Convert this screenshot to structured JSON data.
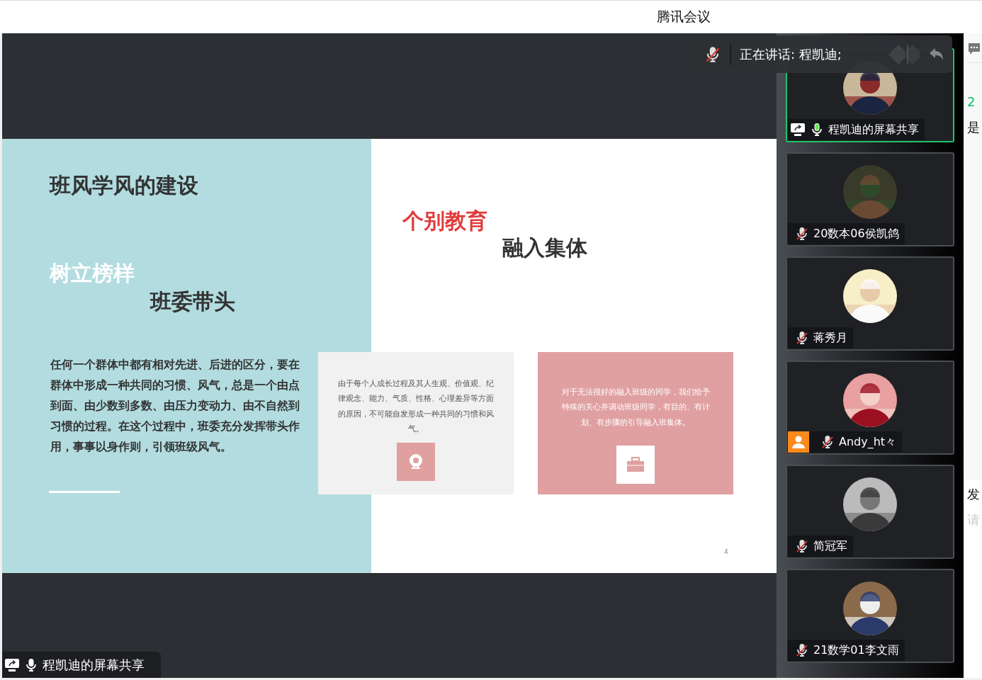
{
  "window": {
    "title": "腾讯会议"
  },
  "speaking_bar": {
    "muted": true,
    "text": "正在讲话: 程凯迪;"
  },
  "slide": {
    "title": "班风学风的建设",
    "heading_light": "树立榜样",
    "heading_dark": "班委带头",
    "paragraph": "任何一个群体中都有相对先进、后进的区分，要在群体中形成一种共同的习惯、风气，总是一个由点到面、由少数到多数、由压力变动力、由不自然到习惯的过程。在这个过程中，班委充分发挥带头作用，事事以身作则，引领班级风气。",
    "accent_heading": "个别教育",
    "sub_heading": "融入集体",
    "cards": [
      {
        "kind": "light",
        "text": "由于每个人成长过程及其人生观、价值观、纪律观念、能力、气质、性格、心理差异等方面的原因，不可能自发形成一种共同的习惯和风气。"
      },
      {
        "kind": "pink",
        "text": "对于无法很好的融入班级的同学，我们给予特殊的关心并调动班级同学，有目的、有计划、有步骤的引导融入班集体。"
      }
    ],
    "page_number": "4"
  },
  "share_label": {
    "muted": false,
    "text": "程凯迪的屏幕共享"
  },
  "participants": [
    {
      "name": "程凯迪的屏幕共享",
      "muted": false,
      "sharing": true,
      "host": false,
      "speaking": true
    },
    {
      "name": "20数本06侯凯鸽",
      "muted": true,
      "sharing": false,
      "host": false,
      "speaking": false
    },
    {
      "name": "蒋秀月",
      "muted": true,
      "sharing": false,
      "host": false,
      "speaking": false
    },
    {
      "name": "Andy_ht々",
      "muted": true,
      "sharing": false,
      "host": true,
      "speaking": false
    },
    {
      "name": "简冠军",
      "muted": true,
      "sharing": false,
      "host": false,
      "speaking": false
    },
    {
      "name": "21数学01李文雨",
      "muted": true,
      "sharing": false,
      "host": false,
      "speaking": false
    }
  ],
  "side_panel": {
    "top_texts": [
      {
        "kind": "count",
        "text": "2"
      },
      {
        "kind": "plain",
        "text": "是"
      }
    ],
    "bottom_texts": [
      {
        "kind": "plain",
        "text": "发"
      },
      {
        "kind": "hint",
        "text": "请"
      }
    ]
  }
}
